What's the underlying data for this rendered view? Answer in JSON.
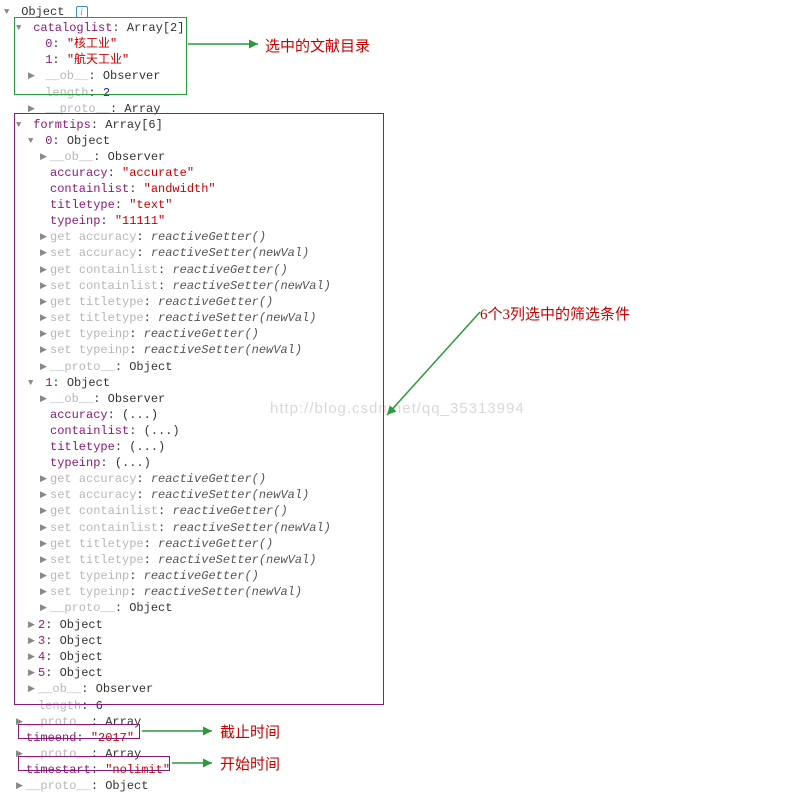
{
  "watermark": "http://blog.csdn.net/qq_35313994",
  "root": {
    "label": "Object"
  },
  "cataloglist": {
    "label": "cataloglist",
    "type": "Array[2]",
    "items": [
      "\"核工业\"",
      "\"航天工业\""
    ],
    "ob": "Observer",
    "length": "2",
    "proto": "Array"
  },
  "formtips": {
    "label": "formtips",
    "type": "Array[6]",
    "ob": "Observer",
    "length": "6",
    "proto": "Array",
    "item0": {
      "label": "0",
      "type": "Object",
      "ob": "Observer",
      "accuracy": "\"accurate\"",
      "containlist": "\"andwidth\"",
      "titletype": "\"text\"",
      "typeinp": "\"11111\"",
      "getset": [
        "get accuracy: reactiveGetter()",
        "set accuracy: reactiveSetter(newVal)",
        "get containlist: reactiveGetter()",
        "set containlist: reactiveSetter(newVal)",
        "get titletype: reactiveGetter()",
        "set titletype: reactiveSetter(newVal)",
        "get typeinp: reactiveGetter()",
        "set typeinp: reactiveSetter(newVal)"
      ],
      "proto": "Object"
    },
    "item1": {
      "label": "1",
      "type": "Object",
      "ob": "Observer",
      "fields": [
        "accuracy",
        "containlist",
        "titletype",
        "typeinp"
      ],
      "ellipsis": "(...)",
      "getset": [
        "get accuracy: reactiveGetter()",
        "set accuracy: reactiveSetter(newVal)",
        "get containlist: reactiveGetter()",
        "set containlist: reactiveSetter(newVal)",
        "get titletype: reactiveGetter()",
        "set titletype: reactiveSetter(newVal)",
        "get typeinp: reactiveGetter()",
        "set typeinp: reactiveSetter(newVal)"
      ],
      "proto": "Object"
    },
    "collapsed": [
      {
        "k": "2",
        "v": "Object"
      },
      {
        "k": "3",
        "v": "Object"
      },
      {
        "k": "4",
        "v": "Object"
      },
      {
        "k": "5",
        "v": "Object"
      }
    ]
  },
  "timeend": {
    "label": "timeend",
    "value": "\"2017\""
  },
  "proto_mid": "Array",
  "timestart": {
    "label": "timestart",
    "value": "\"nolimit\""
  },
  "proto_last": "Object",
  "annotations": {
    "a1": "选中的文献目录",
    "a2": "6个3列选中的筛选条件",
    "a3": "截止时间",
    "a4": "开始时间"
  }
}
